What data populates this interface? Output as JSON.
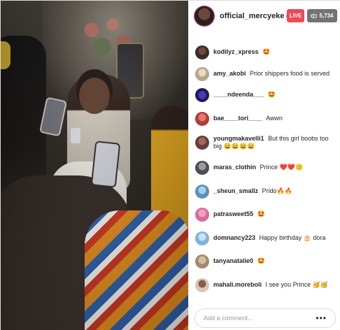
{
  "header": {
    "username": "official_mercyeke",
    "verified": true,
    "live_label": "LIVE",
    "viewer_count": "5,734"
  },
  "comments": [
    {
      "user": "kodilyz_xpress",
      "text": "",
      "emoji": "🤩",
      "avatar_color": "#3a2a2a"
    },
    {
      "user": "amy_akobi",
      "text": "Prior shippers food is served",
      "emoji": "",
      "avatar_color": "#c9b7a3"
    },
    {
      "user": "____ndeenda___",
      "text": "",
      "emoji": "🤩",
      "avatar_color": "#2a2a6a"
    },
    {
      "user": "bae____tori____",
      "text": "Awwn",
      "emoji": "",
      "avatar_color": "#b33a3a"
    },
    {
      "user": "youngmakavelli1",
      "text": "But this girl boobs too big",
      "emoji": "😄😄😄😄",
      "avatar_color": "#6b3a3a"
    },
    {
      "user": "maras_clothin",
      "text": "Prince",
      "emoji": "❤️❤️😕",
      "avatar_color": "#6d6d70"
    },
    {
      "user": "_sheun_smallz",
      "text": "Prido",
      "emoji": "🔥🔥",
      "avatar_color": "#5a8fb8"
    },
    {
      "user": "patrasweet55",
      "text": "",
      "emoji": "🤩",
      "avatar_color": "#d96a9a"
    },
    {
      "user": "domnancy223",
      "text": "Happy birthday",
      "emoji": "🎂",
      "suffix": "dora",
      "avatar_color": "#7fb3d6"
    },
    {
      "user": "tanyanatalie0",
      "text": "",
      "emoji": "🤩",
      "avatar_color": "#a58a6a"
    },
    {
      "user": "mahali.moreboli",
      "text": "I see you Prince",
      "emoji": "🥳🥳",
      "avatar_color": "#d8c7b4"
    }
  ],
  "comment_input": {
    "placeholder": "Add a comment..."
  },
  "icons": {
    "more": "more-options-icon",
    "eye": "eye-icon",
    "verified": "verified-badge-icon"
  },
  "colors": {
    "live": "#ed4956",
    "viewers": "#737373",
    "verified": "#3897f0"
  }
}
